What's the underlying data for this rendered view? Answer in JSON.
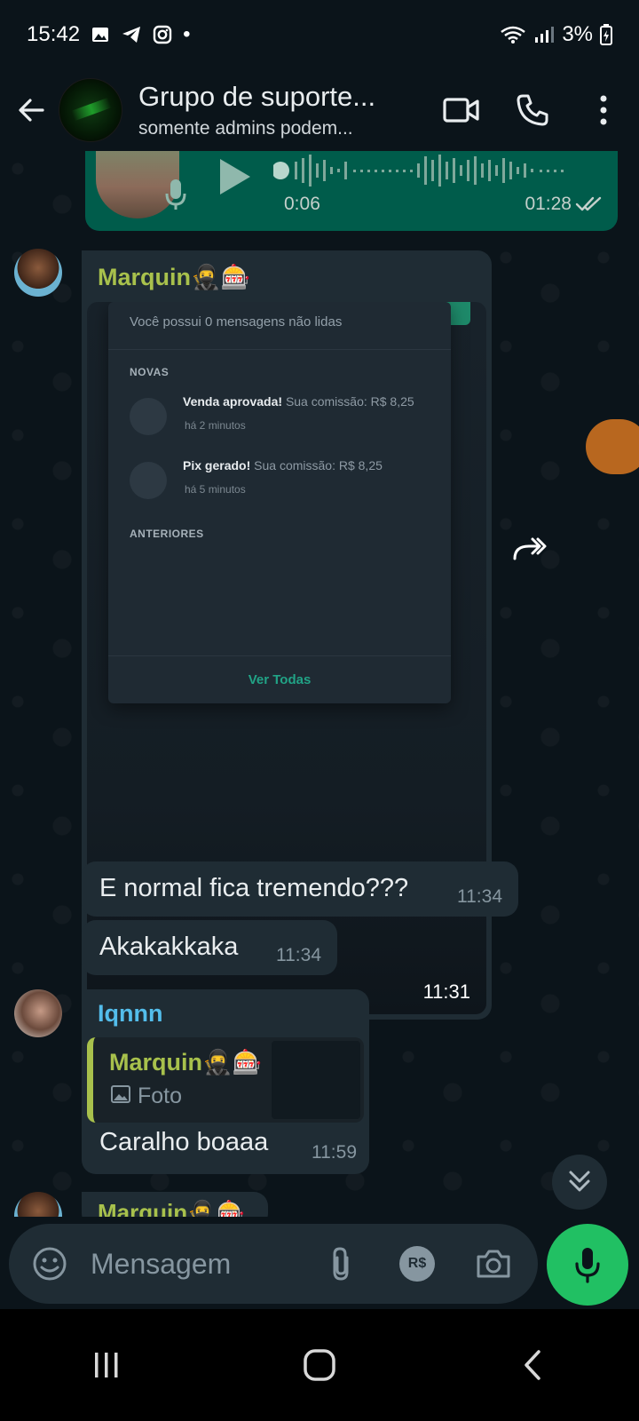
{
  "status_bar": {
    "time": "15:42",
    "battery": "3%",
    "dot": "•"
  },
  "header": {
    "title": "Grupo de suporte...",
    "subtitle": "somente admins podem..."
  },
  "messages": {
    "audio": {
      "duration": "0:06",
      "time": "01:28"
    },
    "photo_message": {
      "sender": "Marquin🥷🎰",
      "time": "11:31",
      "screenshot": {
        "unread": "Você possui 0 mensagens não lidas",
        "section_new": "NOVAS",
        "items": [
          {
            "title": "Venda aprovada!",
            "detail": "Sua comissão: R$ 8,25",
            "ago": "há 2 minutos"
          },
          {
            "title": "Pix gerado!",
            "detail": "Sua comissão: R$ 8,25",
            "ago": "há 5 minutos"
          }
        ],
        "section_old": "ANTERIORES",
        "see_all": "Ver Todas"
      }
    },
    "text1": {
      "text": "E normal fica tremendo???",
      "time": "11:34"
    },
    "text2": {
      "text": "Akakakkaka",
      "time": "11:34"
    },
    "reply_message": {
      "sender": "Iqnnn",
      "quoted_sender": "Marquin🥷🎰",
      "quoted_type": "Foto",
      "text": "Caralho boaaa",
      "time": "11:59"
    },
    "partial_sender": "Marquin🥷🎰"
  },
  "input": {
    "placeholder": "Mensagem",
    "pix_label": "R$"
  },
  "colors": {
    "background": "#0b141a",
    "bubble": "#1f2c34",
    "outgoing": "#005c4b",
    "accent_green": "#21c063",
    "sender_marquin": "#a8c14c",
    "sender_iqnnn": "#53bdeb"
  },
  "icons": [
    "gallery-icon",
    "telegram-icon",
    "instagram-icon",
    "wifi-icon",
    "signal-icon",
    "battery-icon",
    "back-arrow-icon",
    "video-call-icon",
    "phone-icon",
    "more-vert-icon",
    "play-icon",
    "mic-icon",
    "double-check-icon",
    "forward-icon",
    "image-icon",
    "chevrons-down-icon",
    "emoji-icon",
    "attach-icon",
    "camera-icon",
    "recent-apps-icon",
    "home-icon",
    "nav-back-icon"
  ]
}
